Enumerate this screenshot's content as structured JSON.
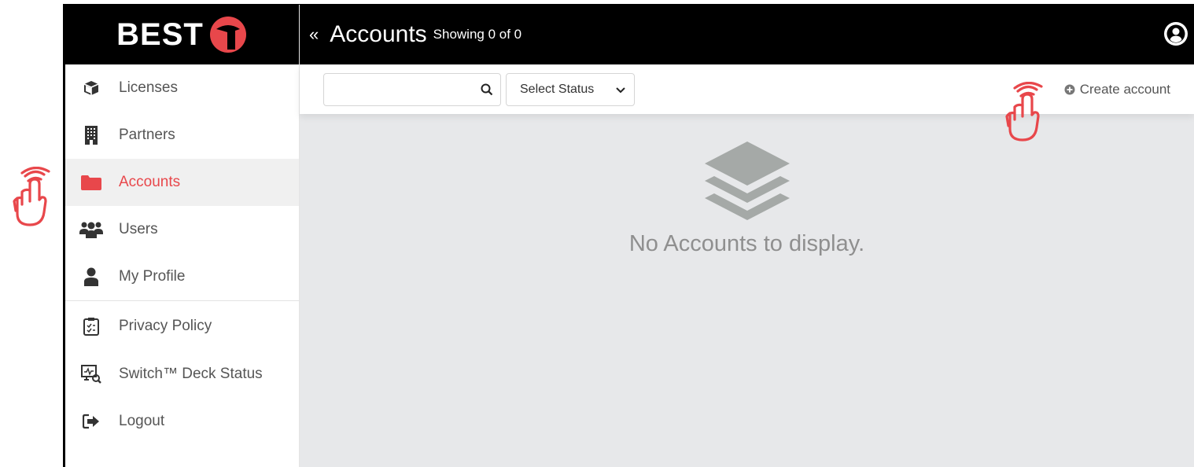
{
  "brand": {
    "name": "BEST"
  },
  "sidebar": {
    "items": [
      {
        "label": "Licenses",
        "icon": "cube-icon"
      },
      {
        "label": "Partners",
        "icon": "building-icon"
      },
      {
        "label": "Accounts",
        "icon": "folder-icon",
        "active": true
      },
      {
        "label": "Users",
        "icon": "users-icon"
      },
      {
        "label": "My Profile",
        "icon": "user-icon"
      },
      {
        "label": "Privacy Policy",
        "icon": "clipboard-icon"
      },
      {
        "label": "Switch™ Deck Status",
        "icon": "monitor-search-icon"
      },
      {
        "label": "Logout",
        "icon": "logout-icon"
      }
    ]
  },
  "header": {
    "collapse": "«",
    "title": "Accounts",
    "subtitle": "Showing 0 of 0"
  },
  "toolbar": {
    "search_value": "",
    "status_select": "Select Status",
    "create_label": "Create account"
  },
  "empty_state": {
    "message": "No Accounts to display."
  },
  "colors": {
    "accent": "#e8474b",
    "header_bg": "#000000",
    "content_bg": "#e7e8ea"
  }
}
